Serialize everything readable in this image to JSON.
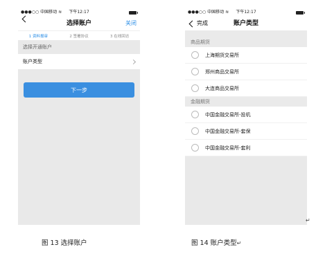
{
  "left_screen": {
    "status": {
      "carrier": "●●●○○ 中国移动",
      "time": "下午12:17"
    },
    "nav": {
      "title": "选择账户",
      "close_label": "关闭"
    },
    "steps": [
      "1 资料报审",
      "2 签署协议",
      "3 在线回访"
    ],
    "section_header": "选择开通账户",
    "row_label": "账户类型",
    "next_button": "下一步"
  },
  "right_screen": {
    "status": {
      "carrier": "●●●○○ 中国移动",
      "time": "下午12:17"
    },
    "nav": {
      "back_label": "完成",
      "title": "账户类型"
    },
    "groups": [
      {
        "header": "商品期货",
        "options": [
          "上海期货交易所",
          "郑州商品交易所",
          "大连商品交易所"
        ]
      },
      {
        "header": "金融期货",
        "options": [
          "中国金融交易所-投机",
          "中国金融交易所-套保",
          "中国金融交易所-套利"
        ]
      }
    ]
  },
  "captions": {
    "left": "图 13 选择账户",
    "right": "图 14 账户类型",
    "para_mark": "↵"
  }
}
